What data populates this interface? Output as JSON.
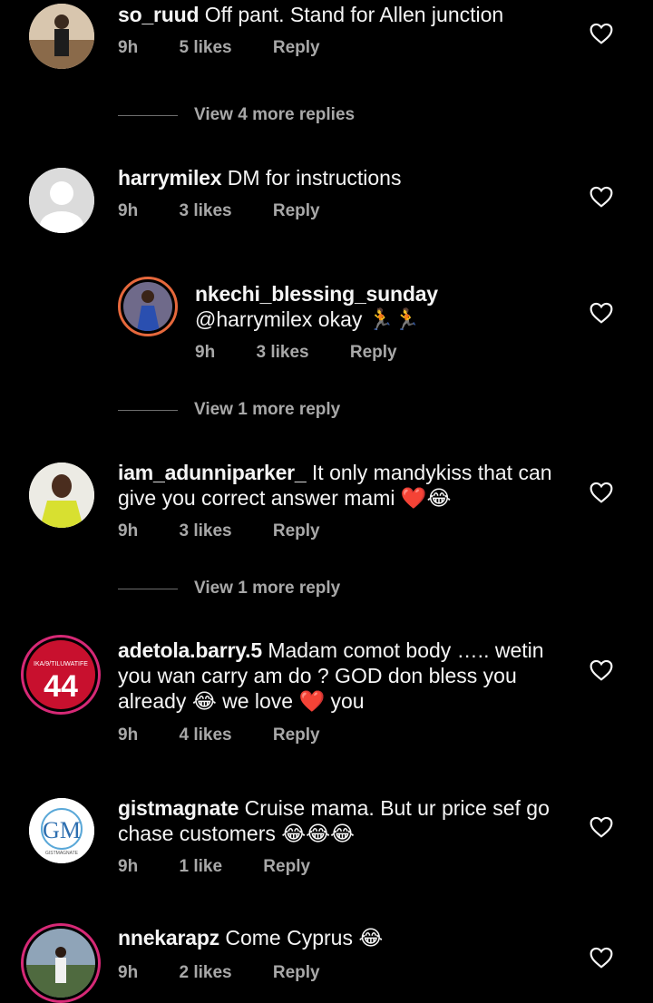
{
  "comments": [
    {
      "user": "so_ruud",
      "text": "Off pant. Stand for Allen junction",
      "time": "9h",
      "likes": "5 likes",
      "reply": "Reply"
    },
    {
      "user": "harrymilex",
      "text": "DM for instructions",
      "time": "9h",
      "likes": "3 likes",
      "reply": "Reply"
    },
    {
      "user": "nkechi_blessing_sunday",
      "text": "@harrymilex okay 🏃🏃",
      "time": "9h",
      "likes": "3 likes",
      "reply": "Reply"
    },
    {
      "user": "iam_adunniparker_",
      "text_l1": "It only mandykiss that can",
      "text_l2": "give you correct answer mami ❤️😂",
      "time": "9h",
      "likes": "3 likes",
      "reply": "Reply"
    },
    {
      "user": "adetola.barry.5",
      "text_l1": "Madam comot body ….. wetin",
      "text_l2": "you wan carry am do ? GOD don bless you",
      "text_l3": "already 😂 we love ❤️ you",
      "time": "9h",
      "likes": "4 likes",
      "reply": "Reply",
      "avatar_jersey": "44",
      "avatar_jersey_name": "IKA/9/TILUWATIFE"
    },
    {
      "user": "gistmagnate",
      "text_l1": "Cruise mama. But ur price sef go",
      "text_l2": "chase customers 😂😂😂",
      "time": "9h",
      "likes": "1 like",
      "reply": "Reply",
      "avatar_logo": "GM",
      "avatar_logo_sub": "GISTMAGNATE"
    },
    {
      "user": "nnekarapz",
      "text": "Come Cyprus 😂",
      "time": "9h",
      "likes": "2 likes",
      "reply": "Reply"
    }
  ],
  "view_more": [
    "View 4 more replies",
    "View 1 more reply",
    "View 1 more reply"
  ],
  "colors": {
    "background": "#000000",
    "text": "#f5f5f5",
    "meta": "#a8a8a8",
    "story_ring": "#e1306c"
  },
  "icons": {
    "like": "heart-outline-icon"
  }
}
